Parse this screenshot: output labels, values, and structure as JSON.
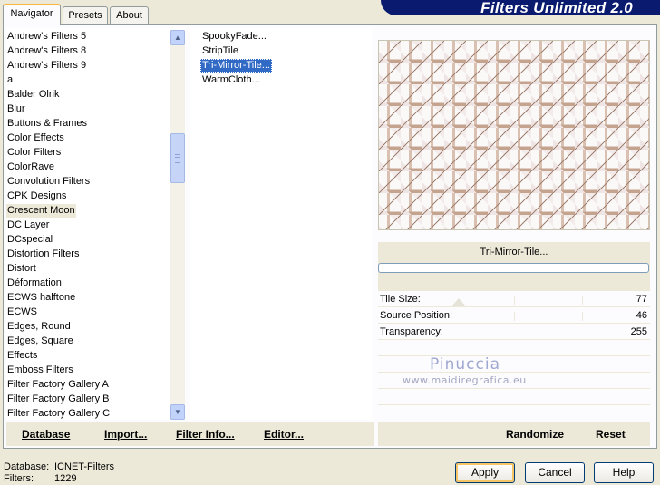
{
  "tabs": [
    {
      "label": "Navigator"
    },
    {
      "label": "Presets"
    },
    {
      "label": "About"
    }
  ],
  "app_title": "Filters Unlimited 2.0",
  "categories": [
    "Andrew's Filters 5",
    "Andrew's Filters 8",
    "Andrew's Filters 9",
    "a",
    "Balder Olrik",
    "Blur",
    "Buttons & Frames",
    "Color Effects",
    "Color Filters",
    "ColorRave",
    "Convolution Filters",
    "CPK Designs",
    "Crescent Moon",
    "DC Layer",
    "DCspecial",
    "Distortion Filters",
    "Distort",
    "Déformation",
    "ECWS halftone",
    "ECWS",
    "Edges, Round",
    "Edges, Square",
    "Effects",
    "Emboss Filters",
    "Filter Factory Gallery A",
    "Filter Factory Gallery B",
    "Filter Factory Gallery C"
  ],
  "selected_category": "Crescent Moon",
  "filters": [
    "SpookyFade...",
    "StripTile",
    "Tri-Mirror-Tile...",
    "WarmCloth..."
  ],
  "selected_filter": "Tri-Mirror-Tile...",
  "preview": {
    "filter_name": "Tri-Mirror-Tile...",
    "progress": 0
  },
  "parameters": [
    {
      "name": "Tile Size:",
      "value": "77"
    },
    {
      "name": "Source Position:",
      "value": "46"
    },
    {
      "name": "Transparency:",
      "value": "255"
    }
  ],
  "watermark": {
    "name": "Pinuccia",
    "url": "www.maidiregrafica.eu"
  },
  "toolbar": {
    "database": "Database",
    "import": "Import...",
    "filter_info": "Filter Info...",
    "editor": "Editor...",
    "randomize": "Randomize",
    "reset": "Reset"
  },
  "status": {
    "database_label": "Database:",
    "database_value": "ICNET-Filters",
    "filters_label": "Filters:",
    "filters_value": "1229"
  },
  "buttons": {
    "apply": "Apply",
    "cancel": "Cancel",
    "help": "Help"
  }
}
